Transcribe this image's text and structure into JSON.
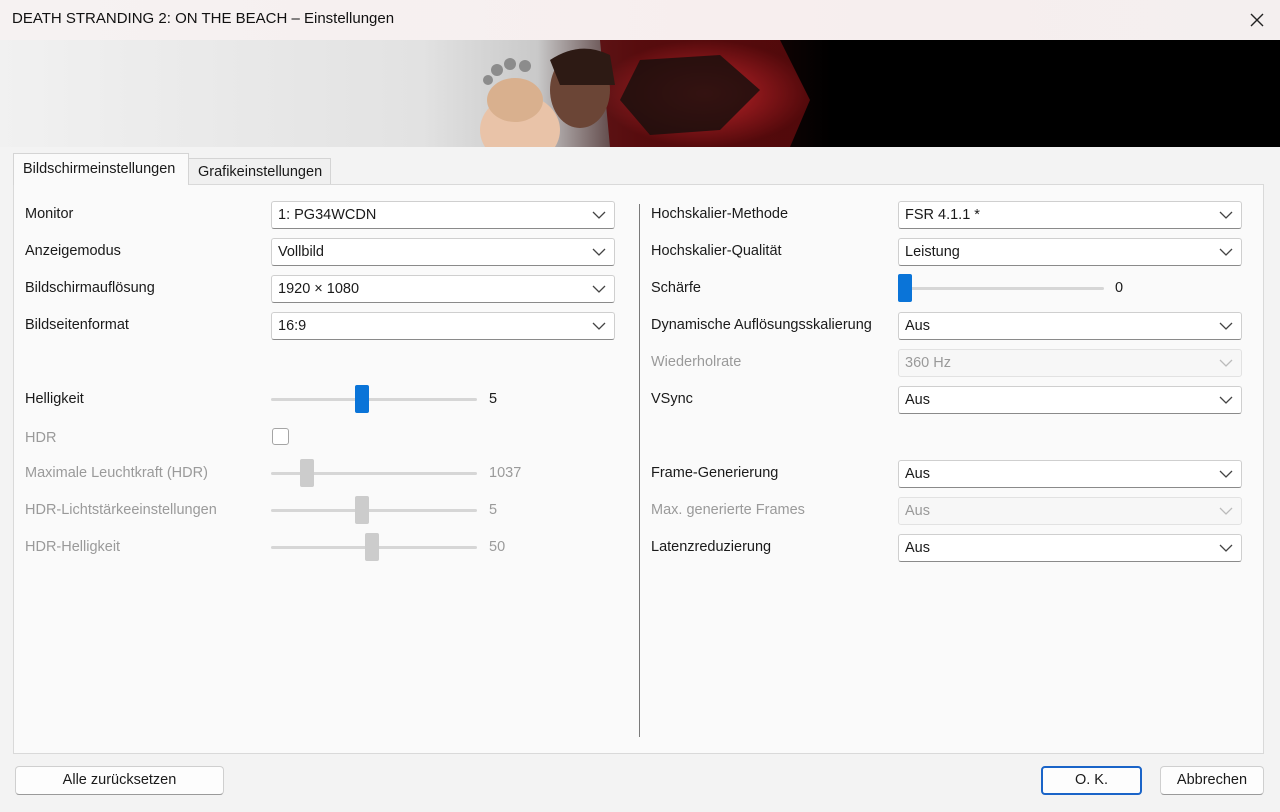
{
  "window": {
    "title": "DEATH STRANDING 2: ON THE BEACH – Einstellungen",
    "close_icon": "close-icon"
  },
  "tabs": [
    {
      "label": "Bildschirmeinstellungen",
      "active": true
    },
    {
      "label": "Grafikeinstellungen",
      "active": false
    }
  ],
  "left": {
    "monitor": {
      "label": "Monitor",
      "value": "1: PG34WCDN"
    },
    "display_mode": {
      "label": "Anzeigemodus",
      "value": "Vollbild"
    },
    "resolution": {
      "label": "Bildschirmauflösung",
      "value": "1920 × 1080"
    },
    "aspect": {
      "label": "Bildseitenformat",
      "value": "16:9"
    },
    "brightness": {
      "label": "Helligkeit",
      "value": "5"
    },
    "hdr": {
      "label": "HDR",
      "checked": false
    },
    "max_luminance": {
      "label": "Maximale Leuchtkraft (HDR)",
      "value": "1037"
    },
    "hdr_luminance": {
      "label": "HDR-Lichtstärkeeinstellungen",
      "value": "5"
    },
    "hdr_brightness": {
      "label": "HDR-Helligkeit",
      "value": "50"
    }
  },
  "right": {
    "upscale_method": {
      "label": "Hochskalier-Methode",
      "value": "FSR 4.1.1 *"
    },
    "upscale_quality": {
      "label": "Hochskalier-Qualität",
      "value": "Leistung"
    },
    "sharpness": {
      "label": "Schärfe",
      "value": "0"
    },
    "dynamic_res": {
      "label": "Dynamische Auflösungsskalierung",
      "value": "Aus"
    },
    "refresh_rate": {
      "label": "Wiederholrate",
      "value": "360 Hz"
    },
    "vsync": {
      "label": "VSync",
      "value": "Aus"
    },
    "frame_gen": {
      "label": "Frame-Generierung",
      "value": "Aus"
    },
    "max_frames": {
      "label": "Max. generierte Frames",
      "value": "Aus"
    },
    "latency": {
      "label": "Latenzreduzierung",
      "value": "Aus"
    }
  },
  "buttons": {
    "reset": "Alle zurücksetzen",
    "ok": "O. K.",
    "cancel": "Abbrechen"
  },
  "colors": {
    "accent": "#0a74d8",
    "ok_border": "#1a64c8",
    "disabled_text": "#9a9a9a"
  }
}
